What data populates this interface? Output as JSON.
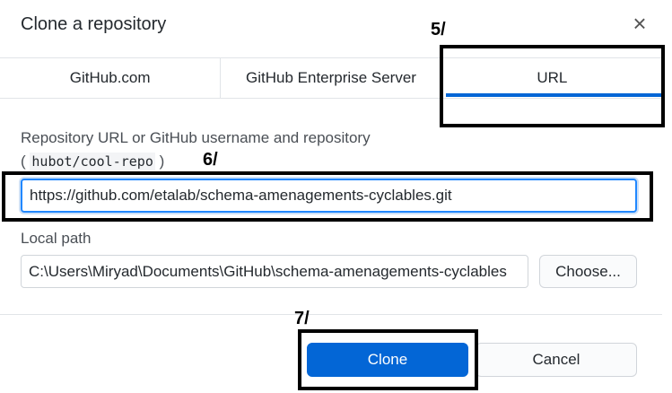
{
  "dialog": {
    "title": "Clone a repository",
    "close_symbol": "×"
  },
  "tabs": [
    {
      "label": "GitHub.com",
      "active": false
    },
    {
      "label": "GitHub Enterprise Server",
      "active": false
    },
    {
      "label": "URL",
      "active": true
    }
  ],
  "repo_field": {
    "label": "Repository URL or GitHub username and repository",
    "hint_open": "(",
    "hint_code": "hubot/cool-repo",
    "hint_close": ")",
    "value": "https://github.com/etalab/schema-amenagements-cyclables.git"
  },
  "local_path": {
    "label": "Local path",
    "value": "C:\\Users\\Miryad\\Documents\\GitHub\\schema-amenagements-cyclables",
    "choose_label": "Choose..."
  },
  "footer": {
    "clone_label": "Clone",
    "cancel_label": "Cancel"
  },
  "annotations": [
    {
      "label": "5/"
    },
    {
      "label": "6/"
    },
    {
      "label": "7/"
    }
  ],
  "colors": {
    "accent": "#0366d6",
    "annotation": "#000000"
  }
}
